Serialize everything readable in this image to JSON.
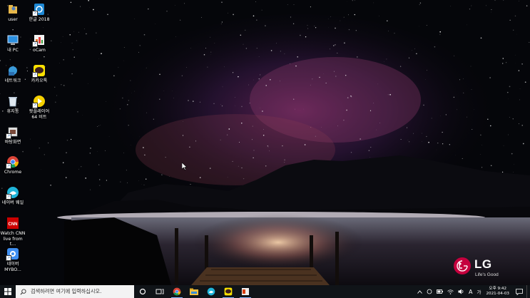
{
  "desktop": {
    "icons": [
      {
        "label": "user",
        "icon": "user-folder-icon"
      },
      {
        "label": "한글 2018",
        "icon": "hangul-2018-icon"
      },
      {
        "label": "내 PC",
        "icon": "this-pc-icon"
      },
      {
        "label": "oCam",
        "icon": "ocam-icon"
      },
      {
        "label": "네트워크",
        "icon": "network-icon"
      },
      {
        "label": "카카오톡",
        "icon": "kakaotalk-icon"
      },
      {
        "label": "휴지통",
        "icon": "recycle-bin-icon"
      },
      {
        "label": "팟플레이어 64 비트",
        "icon": "potplayer-icon"
      },
      {
        "label": "바탕화면",
        "icon": "desktop-folder-icon"
      },
      {
        "label": "Chrome",
        "icon": "chrome-icon"
      },
      {
        "label": "네이버 웨일",
        "icon": "naver-whale-icon"
      },
      {
        "label": "Watch CNN live from t...",
        "icon": "cnn-icon"
      },
      {
        "label": "네이버 MYBO...",
        "icon": "naver-mybox-icon"
      }
    ]
  },
  "brand": {
    "logo_text": "LG",
    "tagline": "Life's Good",
    "color": "#c5003e"
  },
  "taskbar": {
    "search_placeholder": "검색하려면 여기에 입력하십시오.",
    "pinned": [
      "cortana-icon",
      "task-view-icon",
      "chrome-icon",
      "file-explorer-icon",
      "naver-whale-icon",
      "kakaotalk-icon",
      "office-icon"
    ],
    "tray": {
      "ime": "A",
      "ime_mode": "가",
      "time": "오후 9:42",
      "date": "2021-04-03"
    }
  },
  "colors": {
    "taskbar_bg": "#101418",
    "search_bg": "#f3f3f3"
  }
}
